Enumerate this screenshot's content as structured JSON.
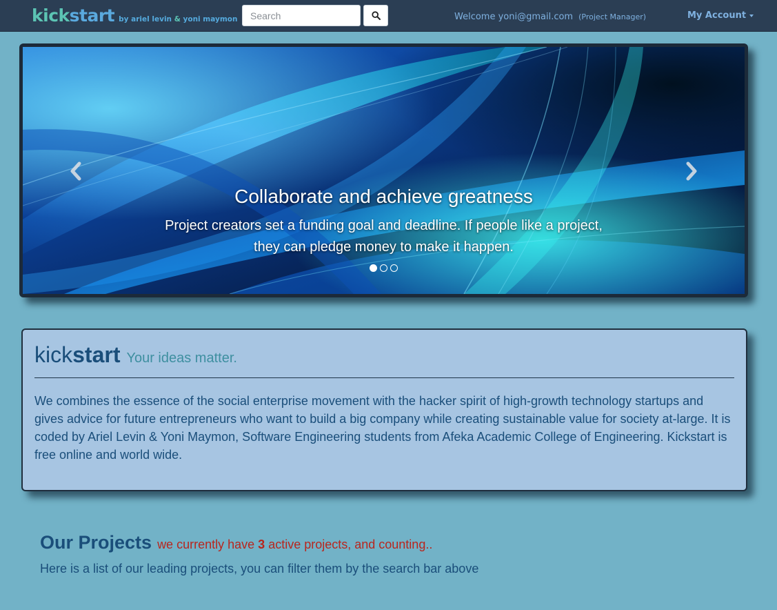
{
  "navbar": {
    "brand_kick": "kick",
    "brand_start": "start",
    "brand_by": "by ariel levin",
    "brand_amp": "&",
    "brand_second": "yoni maymon",
    "search_placeholder": "Search",
    "search_icon": "magnifier-icon",
    "welcome": "Welcome yoni@gmail.com",
    "role": "(Project Manager)",
    "account_label": "My Account"
  },
  "carousel": {
    "title": "Collaborate and achieve greatness",
    "text": "Project creators set a funding goal and deadline. If people like a project, they can pledge money to make it happen.",
    "prev_icon": "chevron-left-icon",
    "next_icon": "chevron-right-icon",
    "slide_count": 3,
    "active_slide": 1
  },
  "about": {
    "kick": "kick",
    "start": "start",
    "tagline": "Your ideas matter.",
    "body": "We combines the essence of the social enterprise movement with the hacker spirit of high-growth technology startups and gives advice for future entrepreneurs who want to build a big company while creating sustainable value for society at-large. It is coded by Ariel Levin & Yoni Maymon, Software Engineering students from Afeka Academic College of Engineering. Kickstart is free online and world wide."
  },
  "projects": {
    "title": "Our Projects",
    "count_prefix": "we currently have",
    "count": "3",
    "count_suffix": "active projects, and counting..",
    "subtitle": "Here is a list of our leading projects, you can filter them by the search bar above"
  },
  "colors": {
    "page_background": "#72b2c7",
    "navbar_background": "#2b3e54",
    "panel_background": "#a7c5e2",
    "heading_blue": "#1a4e7a",
    "count_red": "#b8261e"
  }
}
